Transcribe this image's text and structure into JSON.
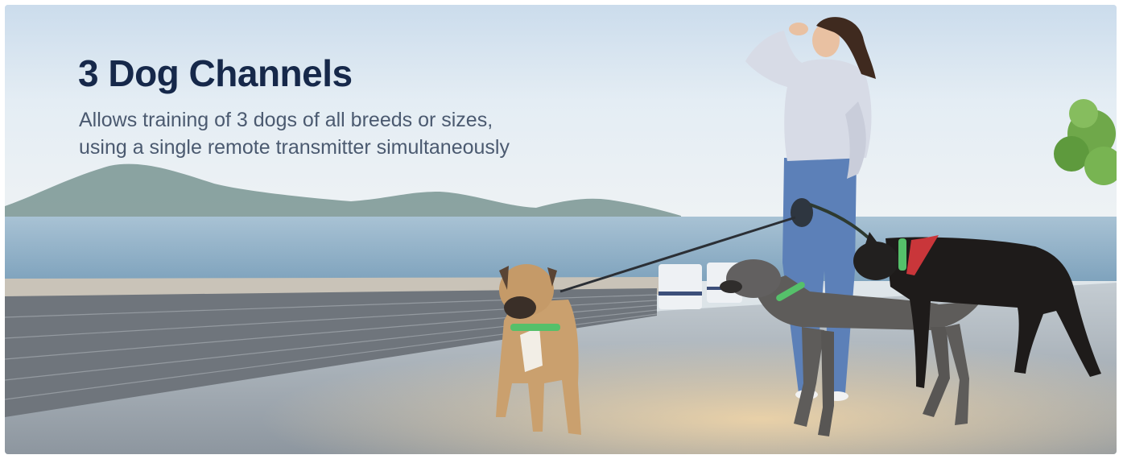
{
  "feature": {
    "title": "3 Dog Channels",
    "description_lines": [
      "Allows training of 3 dogs of all breeds or sizes,",
      "using a single remote transmitter simultaneously"
    ]
  },
  "photo": {
    "subjects": [
      "woman",
      "boxer-mix-dog",
      "gray-dog",
      "black-dog"
    ],
    "collar_accent_color": "#55c06a",
    "scene_colors": {
      "sky": "#dde9f3",
      "sea": "#8eb1c8",
      "pavement": "#9aa3ad",
      "wall": "#6b7178"
    }
  }
}
